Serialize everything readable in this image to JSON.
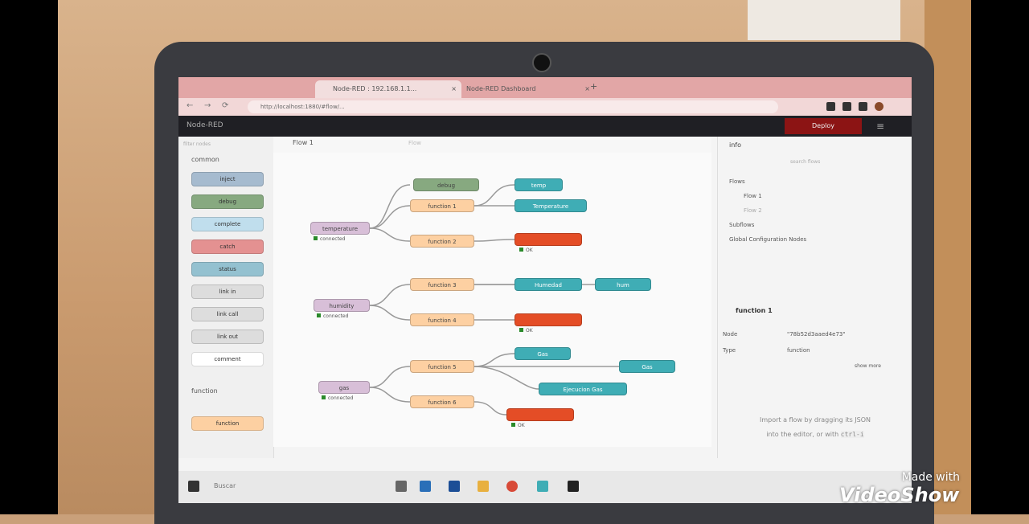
{
  "browser": {
    "tabs": [
      {
        "label": "Node-RED : 192.168.1.1..."
      },
      {
        "label": "Node-RED Dashboard"
      }
    ],
    "new_tab": "+",
    "url": "http://localhost:1880/#flow/...",
    "back": "←",
    "forward": "→",
    "reload": "⟳"
  },
  "nodered": {
    "logo": "Node-RED",
    "deploy": "Deploy",
    "menu_icon": "≡"
  },
  "palette": {
    "filter_placeholder": "filter nodes",
    "category_common": "common",
    "category_function": "function",
    "nodes": [
      "inject",
      "debug",
      "complete",
      "catch",
      "status",
      "link in",
      "link call",
      "link out",
      "comment"
    ],
    "function_nodes": [
      "function"
    ]
  },
  "workspace": {
    "tab": "Flow 1",
    "info": "Flow",
    "nodes": {
      "debug": "debug",
      "temperature": "temperature",
      "function1": "function 1",
      "function2": "function 2",
      "temp": "temp",
      "temp_gauge": "Temperature",
      "humidity": "humidity",
      "function3": "function 3",
      "function4": "function 4",
      "humidad": "Humedad",
      "hum": "hum",
      "gas": "gas",
      "function5": "function 5",
      "function6": "function 6",
      "gas_gauge": "Gas",
      "gas2": "Gas",
      "execute_gas": "Ejecucion Gas"
    },
    "statuses": {
      "connected": "connected",
      "ok": "OK"
    }
  },
  "sidebar": {
    "title": "info",
    "search": "search flows",
    "tree": {
      "flows": "Flows",
      "flow1": "Flow 1",
      "flow2": "Flow 2",
      "subflows": "Subflows",
      "global": "Global Configuration Nodes"
    },
    "selected": {
      "name": "function 1",
      "node_key": "Node",
      "node_val": "\"78b52d3aaed4e73\"",
      "type_key": "Type",
      "type_val": "function",
      "show_more": "show more"
    },
    "tip_line1": "Import a flow by dragging its JSON",
    "tip_line2": "into the editor, or with",
    "tip_key": "ctrl-i"
  },
  "taskbar": {
    "search": "Buscar"
  },
  "watermark": {
    "line1": "Made with",
    "line2": "VideoShow"
  },
  "colors": {
    "inject": "#a6bbcf",
    "debug": "#87a980",
    "function": "#fdd0a2",
    "dashboard": "#3fadb5",
    "mqtt": "#d8bfd8",
    "switch": "#e2d96e",
    "catch": "#e49191"
  }
}
